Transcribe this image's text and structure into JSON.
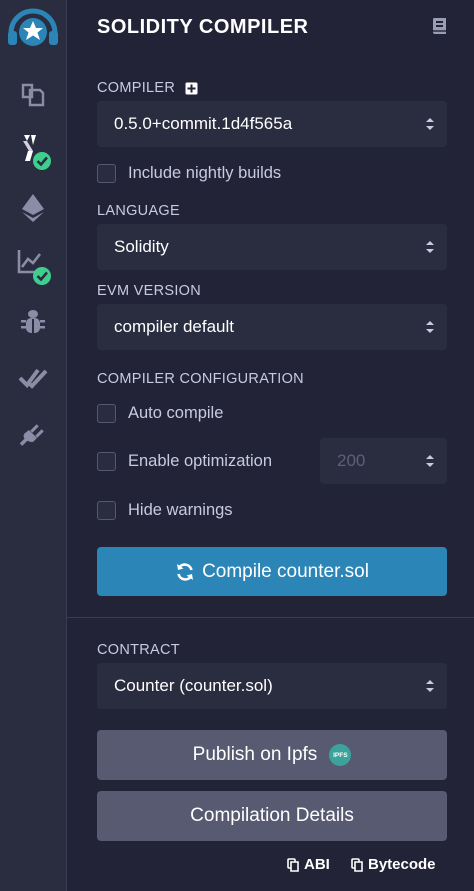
{
  "panel": {
    "title": "SOLIDITY COMPILER"
  },
  "compiler": {
    "label": "COMPILER",
    "version": "0.5.0+commit.1d4f565a",
    "nightly_label": "Include nightly builds"
  },
  "language": {
    "label": "LANGUAGE",
    "value": "Solidity"
  },
  "evm": {
    "label": "EVM VERSION",
    "value": "compiler default"
  },
  "config": {
    "label": "COMPILER CONFIGURATION",
    "auto_compile": "Auto compile",
    "enable_optimization": "Enable optimization",
    "runs_placeholder": "200",
    "hide_warnings": "Hide warnings"
  },
  "compile_button": "Compile counter.sol",
  "contract": {
    "label": "CONTRACT",
    "value": "Counter (counter.sol)"
  },
  "publish": {
    "label": "Publish on Ipfs",
    "badge": "IPFS"
  },
  "details_button": "Compilation Details",
  "copy": {
    "abi": "ABI",
    "bytecode": "Bytecode"
  },
  "colors": {
    "accent": "#2b85b7",
    "success": "#3ecf8e",
    "background": "#222336",
    "sidebar": "#2a2c3f"
  },
  "icons": [
    "remix-logo-icon",
    "file-explorer-icon",
    "solidity-compiler-icon",
    "deploy-run-icon",
    "analysis-icon",
    "debugger-icon",
    "testing-icon",
    "plugin-manager-icon"
  ]
}
